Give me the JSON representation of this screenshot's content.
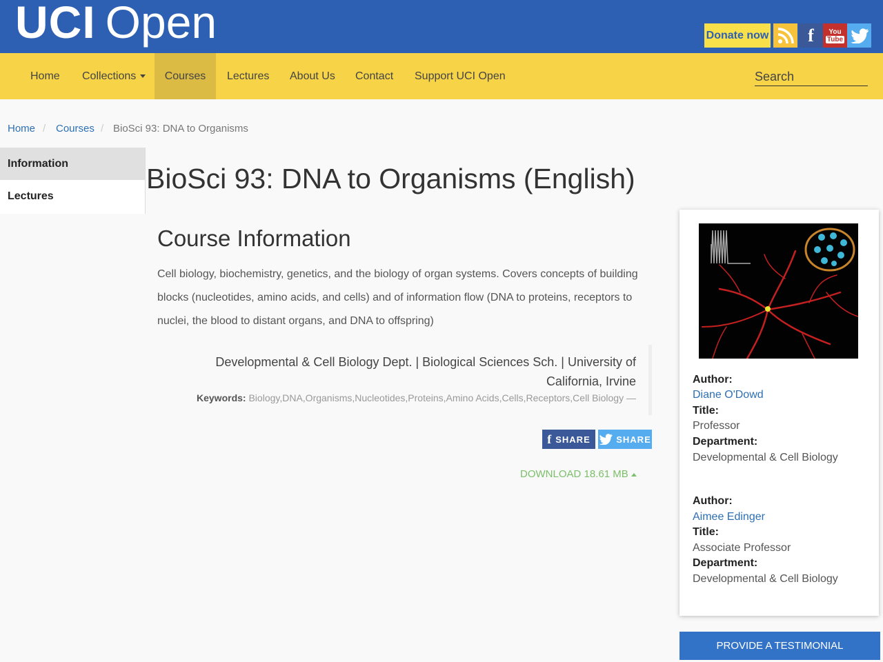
{
  "header": {
    "logo_bold": "UCI",
    "logo_light": "Open",
    "donate_label": "Donate now",
    "social_icons": [
      "rss-icon",
      "facebook-icon",
      "youtube-icon",
      "twitter-icon"
    ],
    "youtube_top": "You",
    "youtube_bottom": "Tube",
    "facebook_glyph": "f"
  },
  "nav": {
    "items": [
      "Home",
      "Collections",
      "Courses",
      "Lectures",
      "About Us",
      "Contact",
      "Support UCI Open"
    ],
    "active": "Courses",
    "search_placeholder": "Search"
  },
  "breadcrumb": {
    "items": [
      "Home",
      "Courses",
      "BioSci 93: DNA to Organisms"
    ],
    "separator": "/"
  },
  "sidebar": {
    "tabs": [
      "Information",
      "Lectures"
    ],
    "active": "Information"
  },
  "main": {
    "title": "BioSci 93: DNA to Organisms (English)",
    "section_title": "Course Information",
    "description": "Cell biology, biochemistry, genetics, and the biology of organ systems. Covers concepts of building blocks (nucleotides, amino acids, and cells) and of information flow (DNA to proteins, receptors to nuclei, the blood to distant organs, and DNA to offspring)",
    "department_line": "Developmental & Cell Biology Dept. | Biological Sciences Sch. | University of California, Irvine",
    "keywords_label": "Keywords:",
    "keywords": "Biology,DNA,Organisms,Nucleotides,Proteins,Amino Acids,Cells,Receptors,Cell Biology —",
    "share_facebook": "SHARE",
    "share_twitter": "SHARE",
    "download_label": "DOWNLOAD 18.61 MB"
  },
  "authors": [
    {
      "author_label": "Author:",
      "name": "Diane O'Dowd",
      "title_label": "Title:",
      "title": "Professor",
      "department_label": "Department:",
      "department": "Developmental & Cell Biology"
    },
    {
      "author_label": "Author:",
      "name": "Aimee Edinger",
      "title_label": "Title:",
      "title": "Associate Professor",
      "department_label": "Department:",
      "department": "Developmental & Cell Biology"
    }
  ],
  "testimonial_label": "PROVIDE A TESTIMONIAL",
  "colors": {
    "header_blue": "#2d5fb3",
    "nav_yellow": "#f6d347",
    "nav_active": "#dbbb44",
    "link_blue": "#2d6fb5",
    "download_green": "#7bbf6a",
    "button_blue": "#3273c8"
  }
}
